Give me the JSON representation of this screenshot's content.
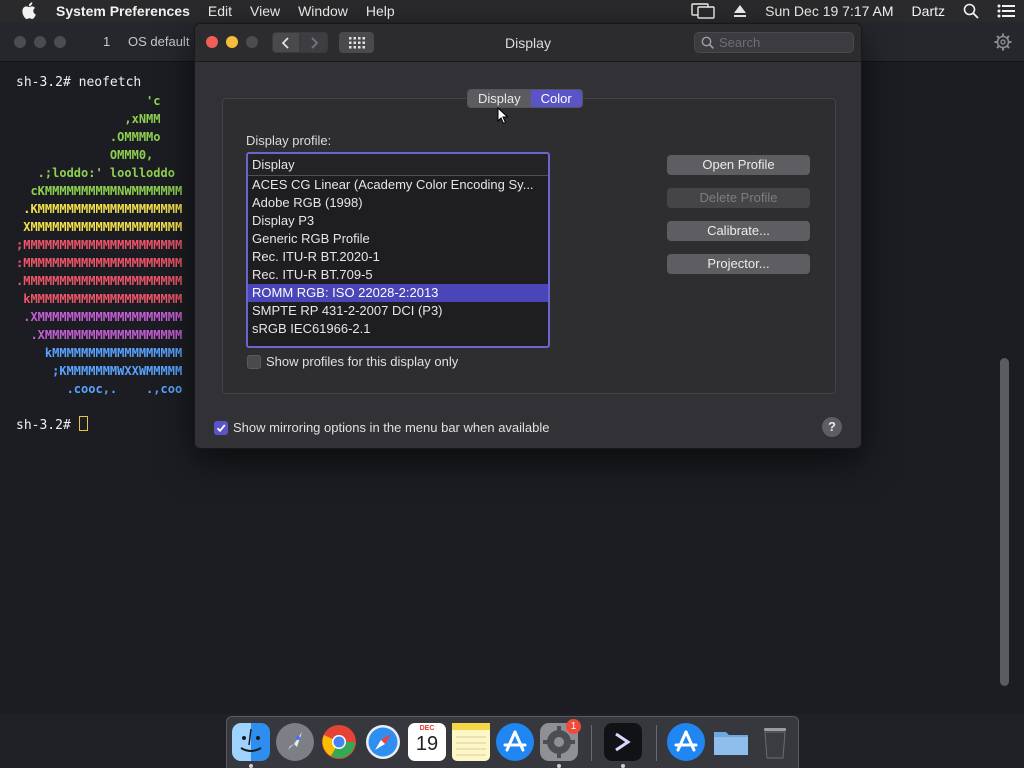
{
  "menubar": {
    "app_name": "System Preferences",
    "items": [
      "Edit",
      "View",
      "Window",
      "Help"
    ],
    "clock": "Sun Dec 19  7:17 AM",
    "user": "Dartz"
  },
  "terminal": {
    "tab_number": "1",
    "tab_title": "OS default",
    "prompt1": "sh-3.2# neofetch",
    "prompt2": "sh-3.2# ",
    "ascii_lines": [
      {
        "text": "                  'c",
        "color": "#8fd14f"
      },
      {
        "text": "               ,xNMM",
        "color": "#8fd14f"
      },
      {
        "text": "             .OMMMMo",
        "color": "#8fd14f"
      },
      {
        "text": "             OMMM0,",
        "color": "#8fd14f"
      },
      {
        "text": "   .;loddo:' loolloddo",
        "color": "#8fd14f"
      },
      {
        "text": "  cKMMMMMMMMMMNWMMMMMMM",
        "color": "#8fd14f"
      },
      {
        "text": " .KMMMMMMMMMMMMMMMMMMMM",
        "color": "#f4e04d"
      },
      {
        "text": " XMMMMMMMMMMMMMMMMMMMMM",
        "color": "#f4e04d"
      },
      {
        "text": ";MMMMMMMMMMMMMMMMMMMMMM",
        "color": "#f0556a"
      },
      {
        "text": ":MMMMMMMMMMMMMMMMMMMMMM",
        "color": "#f0556a"
      },
      {
        "text": ".MMMMMMMMMMMMMMMMMMMMMM",
        "color": "#f0556a"
      },
      {
        "text": " kMMMMMMMMMMMMMMMMMMMMM",
        "color": "#f0556a"
      },
      {
        "text": " .XMMMMMMMMMMMMMMMMMMMM",
        "color": "#c55fd6"
      },
      {
        "text": "  .XMMMMMMMMMMMMMMMMMMM",
        "color": "#c55fd6"
      },
      {
        "text": "    kMMMMMMMMMMMMMMMMMM",
        "color": "#5aa3ff"
      },
      {
        "text": "     ;KMMMMMMMWXXWMMMMM",
        "color": "#5aa3ff"
      },
      {
        "text": "       .cooc,.    .,coo",
        "color": "#5aa3ff"
      }
    ]
  },
  "window": {
    "title": "Display",
    "search_placeholder": "Search",
    "tabs": [
      {
        "label": "Display",
        "active": false
      },
      {
        "label": "Color",
        "active": true
      }
    ],
    "profile_label": "Display profile:",
    "list_header": "Display",
    "profiles": [
      {
        "label": "ACES CG Linear (Academy Color Encoding Sy...",
        "selected": false
      },
      {
        "label": "Adobe RGB (1998)",
        "selected": false
      },
      {
        "label": "Display P3",
        "selected": false
      },
      {
        "label": "Generic RGB Profile",
        "selected": false
      },
      {
        "label": "Rec. ITU-R BT.2020-1",
        "selected": false
      },
      {
        "label": "Rec. ITU-R BT.709-5",
        "selected": false
      },
      {
        "label": "ROMM RGB: ISO 22028-2:2013",
        "selected": true
      },
      {
        "label": "SMPTE RP 431-2-2007 DCI (P3)",
        "selected": false
      },
      {
        "label": "sRGB IEC61966-2.1",
        "selected": false
      }
    ],
    "buttons": {
      "open_profile": "Open Profile",
      "delete_profile": "Delete Profile",
      "calibrate": "Calibrate...",
      "projector": "Projector..."
    },
    "show_profiles_only": "Show profiles for this display only",
    "show_profiles_only_checked": false,
    "mirroring_option": "Show mirroring options in the menu bar when available",
    "mirroring_checked": true,
    "help": "?"
  },
  "dock": {
    "calendar_month": "DEC",
    "calendar_day": "19",
    "prefs_badge": "1"
  },
  "colors": {
    "accent": "#5b54c9",
    "selection": "#4a45b8"
  }
}
